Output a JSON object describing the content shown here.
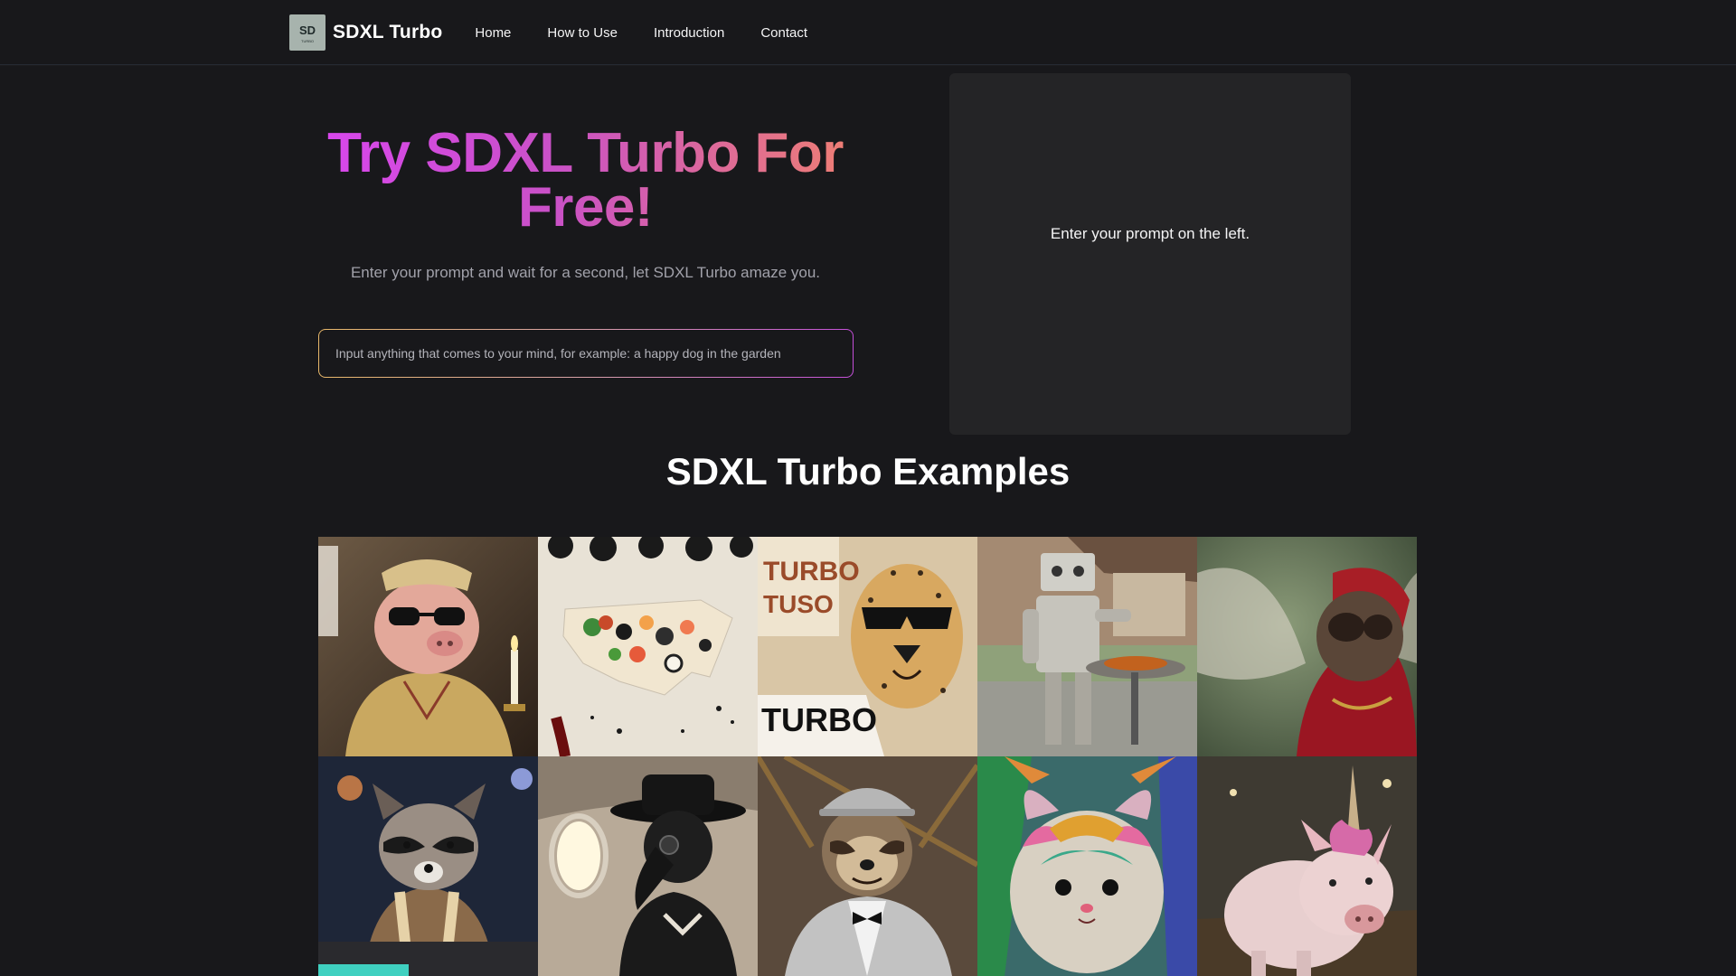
{
  "nav": {
    "brand": "SDXL Turbo",
    "logo_text": "SD",
    "logo_sub": "TURBO",
    "links": [
      "Home",
      "How to Use",
      "Introduction",
      "Contact"
    ]
  },
  "hero": {
    "title": "Try SDXL Turbo For Free!",
    "subtitle": "Enter your prompt and wait for a second, let SDXL Turbo amaze you.",
    "prompt_placeholder": "Input anything that comes to your mind, for example: a happy dog in the garden"
  },
  "output": {
    "message": "Enter your prompt on the left."
  },
  "examples": {
    "title": "SDXL Turbo Examples",
    "tiles": [
      {
        "subject": "pig in robe with sunglasses and candle"
      },
      {
        "subject": "USA map made of sushi with wine"
      },
      {
        "subject": "cheetah with sunglasses",
        "signs": [
          "TURBO",
          "TUSO",
          "TURBO"
        ]
      },
      {
        "subject": "robot cooking at a grill"
      },
      {
        "subject": "fly in red cloak"
      },
      {
        "subject": "raccoon DJ"
      },
      {
        "subject": "plague doctor on airplane"
      },
      {
        "subject": "sloth in tuxedo and hard hat"
      },
      {
        "subject": "colorful hamster"
      },
      {
        "subject": "pig unicorn"
      }
    ]
  },
  "colors": {
    "background": "#18181b",
    "panel": "#242426",
    "title_gradient_start": "#d946ef",
    "title_gradient_end": "#f08070"
  }
}
